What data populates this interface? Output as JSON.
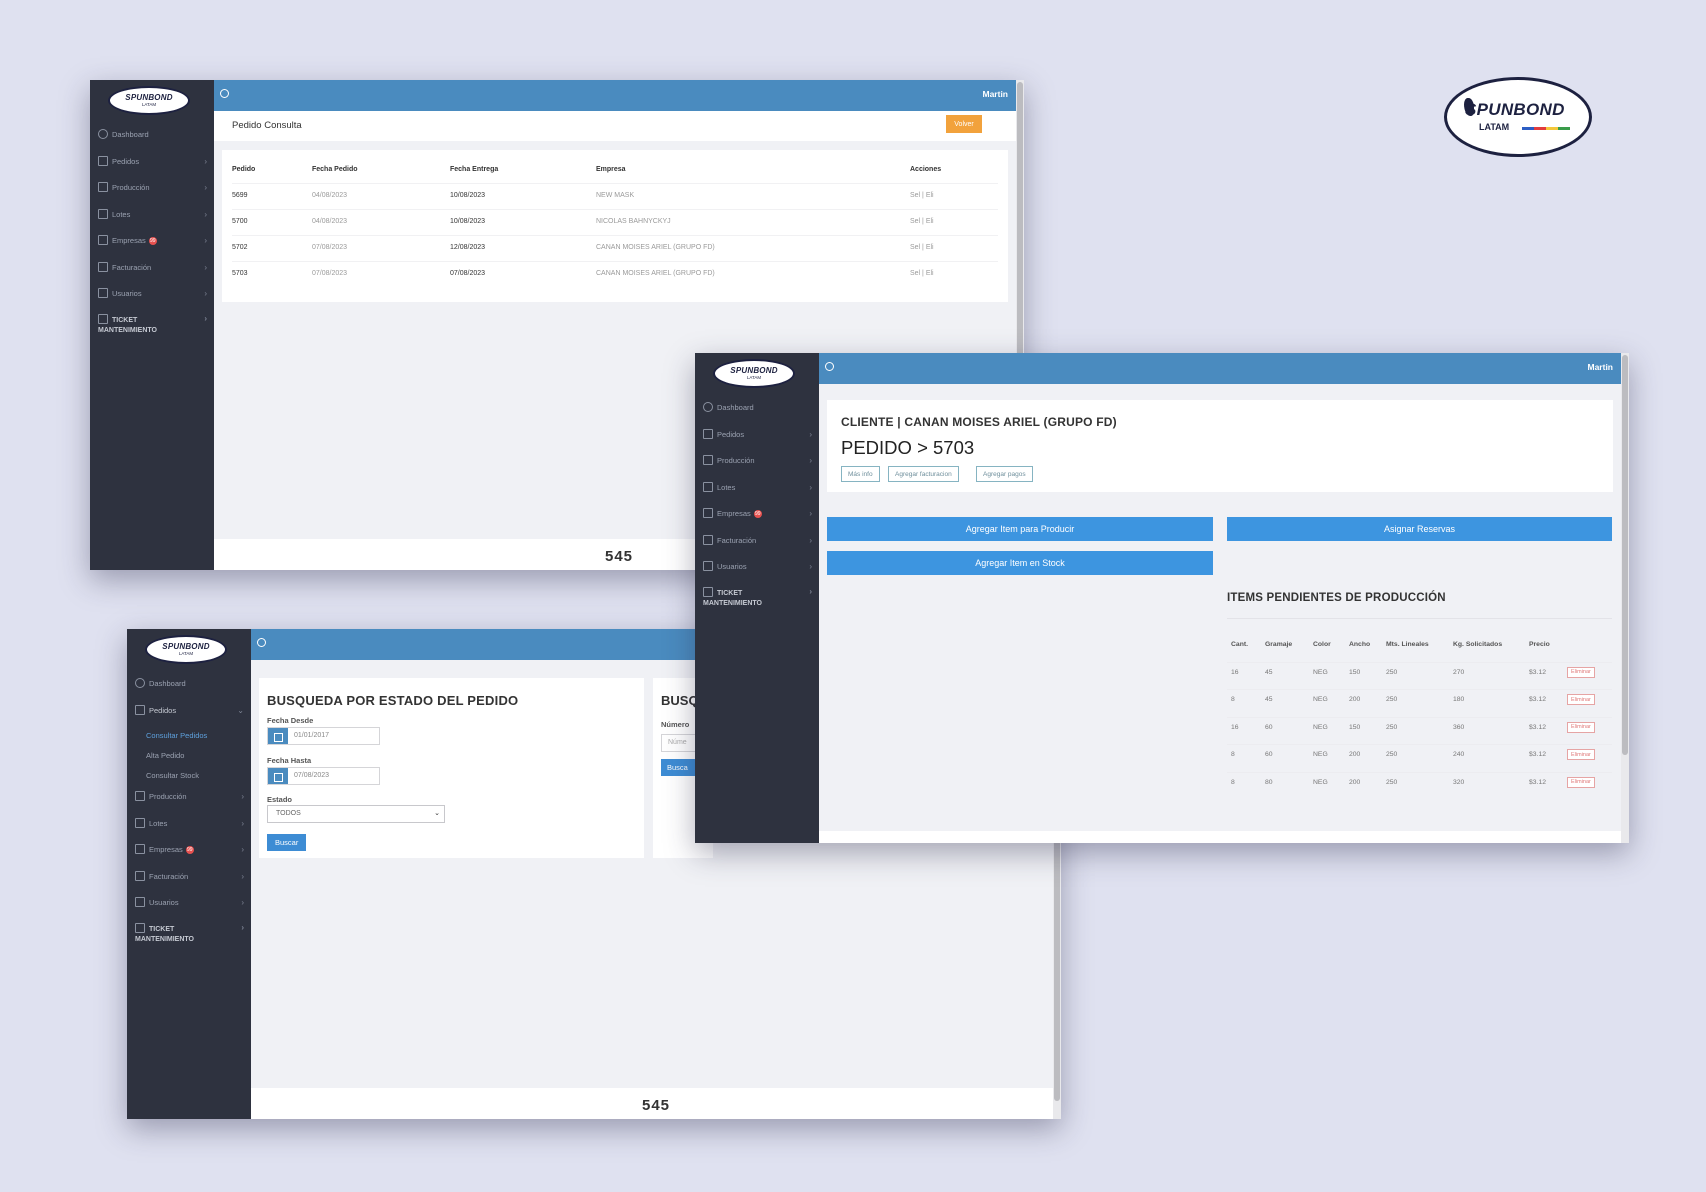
{
  "brand": {
    "logo_text": "SPUNBOND",
    "logo_sub": "LATAM"
  },
  "header": {
    "user": "Martin"
  },
  "sidebar": {
    "items": [
      {
        "label": "Dashboard"
      },
      {
        "label": "Pedidos"
      },
      {
        "label": "Producción"
      },
      {
        "label": "Lotes"
      },
      {
        "label": "Empresas",
        "badge": "99"
      },
      {
        "label": "Facturación"
      },
      {
        "label": "Usuarios"
      },
      {
        "label_line1": "TICKET",
        "label_line2": "MANTENIMIENTO"
      }
    ],
    "pedidos_submenu": [
      "Consultar Pedidos",
      "Alta Pedido",
      "Consultar Stock"
    ]
  },
  "footer": {
    "logo": "545"
  },
  "consulta": {
    "title": "Pedido Consulta",
    "volver": "Volver",
    "columns": [
      "Pedido",
      "Fecha Pedido",
      "Fecha Entrega",
      "Empresa",
      "Acciones"
    ],
    "rows": [
      {
        "pedido": "5699",
        "fecha_pedido": "04/08/2023",
        "fecha_entrega": "10/08/2023",
        "empresa": "NEW MASK",
        "acciones": "Sel | Eli"
      },
      {
        "pedido": "5700",
        "fecha_pedido": "04/08/2023",
        "fecha_entrega": "10/08/2023",
        "empresa": "NICOLAS BAHNYCKYJ",
        "acciones": "Sel | Eli"
      },
      {
        "pedido": "5702",
        "fecha_pedido": "07/08/2023",
        "fecha_entrega": "12/08/2023",
        "empresa": "CANAN MOISES ARIEL (GRUPO FD)",
        "acciones": "Sel | Eli"
      },
      {
        "pedido": "5703",
        "fecha_pedido": "07/08/2023",
        "fecha_entrega": "07/08/2023",
        "empresa": "CANAN MOISES ARIEL (GRUPO FD)",
        "acciones": "Sel | Eli"
      }
    ]
  },
  "busqueda": {
    "title": "BUSQUEDA POR ESTADO DEL PEDIDO",
    "fecha_desde_label": "Fecha Desde",
    "fecha_desde": "01/01/2017",
    "fecha_hasta_label": "Fecha Hasta",
    "fecha_hasta": "07/08/2023",
    "estado_label": "Estado",
    "estado": "TODOS",
    "buscar": "Buscar",
    "second_title": "BUSQ",
    "numero_label": "Número",
    "numero_placeholder": "Núme",
    "second_buscar": "Busca"
  },
  "pedido_detalle": {
    "cliente": "CLIENTE | CANAN MOISES ARIEL (GRUPO FD)",
    "pedido": "PEDIDO > 5703",
    "mas_info": "Más info",
    "agregar_facturacion": "Agregar facturacion",
    "agregar_pagos": "Agregar pagos",
    "agregar_item_producir": "Agregar Item para Producir",
    "asignar_reservas": "Asignar Reservas",
    "agregar_item_stock": "Agregar Item en Stock",
    "items_title": "ITEMS PENDIENTES DE PRODUCCIÓN",
    "columns": [
      "Cant.",
      "Gramaje",
      "Color",
      "Ancho",
      "Mts. Lineales",
      "Kg. Solicitados",
      "Precio"
    ],
    "rows": [
      {
        "cant": "16",
        "gramaje": "45",
        "color": "NEG",
        "ancho": "150",
        "mts": "250",
        "kg": "270",
        "precio": "$3.12",
        "accion": "Eliminar"
      },
      {
        "cant": "8",
        "gramaje": "45",
        "color": "NEG",
        "ancho": "200",
        "mts": "250",
        "kg": "180",
        "precio": "$3.12",
        "accion": "Eliminar"
      },
      {
        "cant": "16",
        "gramaje": "60",
        "color": "NEG",
        "ancho": "150",
        "mts": "250",
        "kg": "360",
        "precio": "$3.12",
        "accion": "Eliminar"
      },
      {
        "cant": "8",
        "gramaje": "60",
        "color": "NEG",
        "ancho": "200",
        "mts": "250",
        "kg": "240",
        "precio": "$3.12",
        "accion": "Eliminar"
      },
      {
        "cant": "8",
        "gramaje": "80",
        "color": "NEG",
        "ancho": "200",
        "mts": "250",
        "kg": "320",
        "precio": "$3.12",
        "accion": "Eliminar"
      }
    ]
  },
  "colors": {
    "header": "#4a8bbf",
    "sidebar": "#2e323f",
    "primary_button": "#3d95e0",
    "volver_button": "#f2a23c",
    "badge": "#e7514f"
  }
}
